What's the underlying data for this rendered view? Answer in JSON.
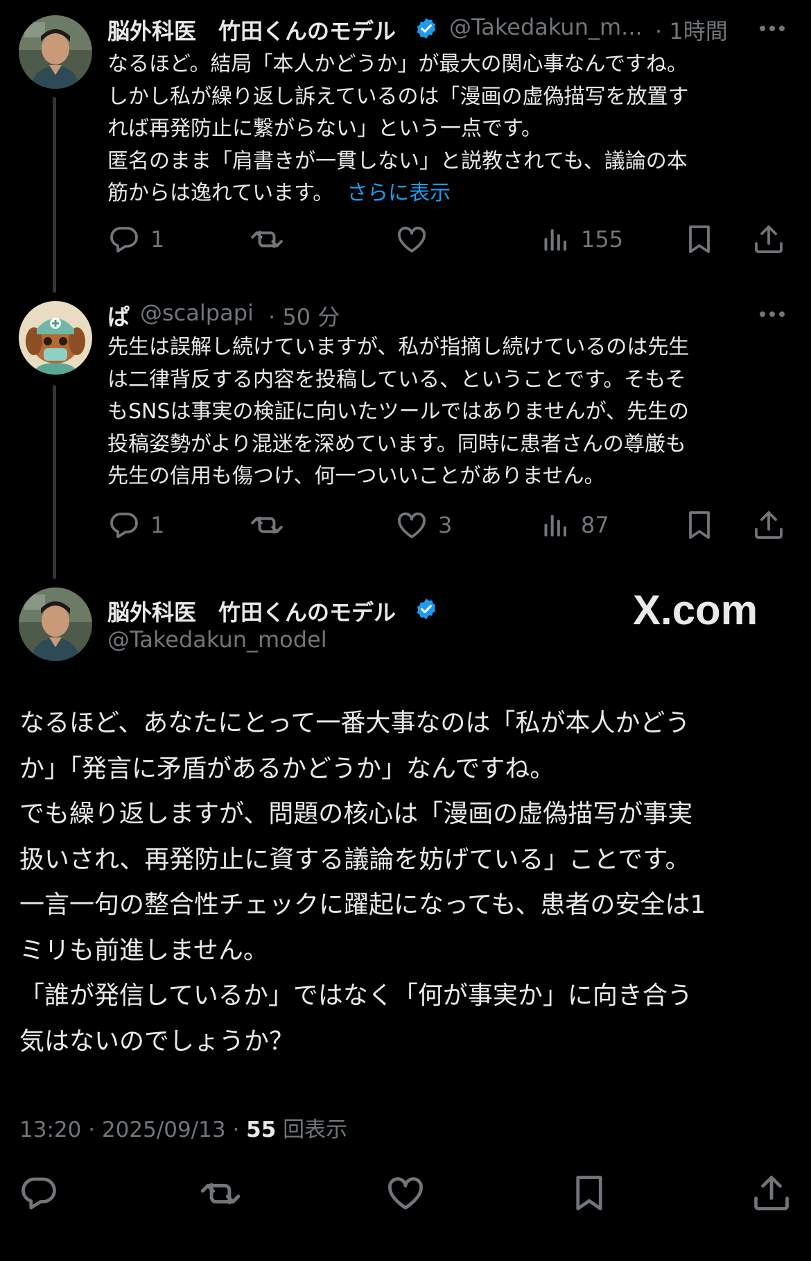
{
  "tweets": [
    {
      "author": "脳外科医　竹田くんのモデル",
      "handle": "@Takedakun_m...",
      "time": "· 1時間",
      "lines": [
        "なるほど。結局「本人かどうか」が最大の関心事なんですね。",
        "しかし私が繰り返し訴えているのは「漫画の虚偽描写を放置す",
        "れば再発防止に繋がらない」という一点です。",
        "匿名のまま「肩書きが一貫しない」と説教されても、議論の本",
        "筋からは逸れています。"
      ],
      "show_more": "さらに表示",
      "replies": "1",
      "retweets": "",
      "likes": "",
      "views": "155"
    },
    {
      "author": "ぱ",
      "handle": "@scalpapi",
      "time": "· 50 分",
      "lines": [
        "先生は誤解し続けていますが、私が指摘し続けているのは先生",
        "は二律背反する内容を投稿している、ということです。そもそ",
        "もSNSは事実の検証に向いたツールではありませんが、先生の",
        "投稿姿勢がより混迷を深めています。同時に患者さんの尊厳も",
        "先生の信用も傷つけ、何一ついいことがありません。"
      ],
      "replies": "1",
      "retweets": "",
      "likes": "3",
      "views": "87"
    }
  ],
  "main": {
    "author": "脳外科医　竹田くんのモデル",
    "handle": "@Takedakun_model",
    "watermark": "X.com",
    "text": "なるほど、あなたにとって一番大事なのは「私が本人かどう\nか」「発言に矛盾があるかどうか」なんですね。\nでも繰り返しますが、問題の核心は「漫画の虚偽描写が事実\n扱いされ、再発防止に資する議論を妨げている」ことです。\n一言一句の整合性チェックに躍起になっても、患者の安全は1\nミリも前進しません。\n「誰が発信しているか」ではなく「何が事実か」に向き合う\n気はないのでしょうか？",
    "timestamp": "13:20 · 2025/09/13 · ",
    "view_count": "55",
    "view_label": " 回表示"
  },
  "colors": {
    "background": "#000000",
    "text": "#e7e9ea",
    "secondary": "#71767b",
    "link": "#1d9bf0",
    "verified": "#1d9bf0"
  },
  "icons": [
    "reply-icon",
    "retweet-icon",
    "like-icon",
    "views-icon",
    "bookmark-icon",
    "share-icon",
    "verified-badge-icon",
    "more-icon"
  ]
}
